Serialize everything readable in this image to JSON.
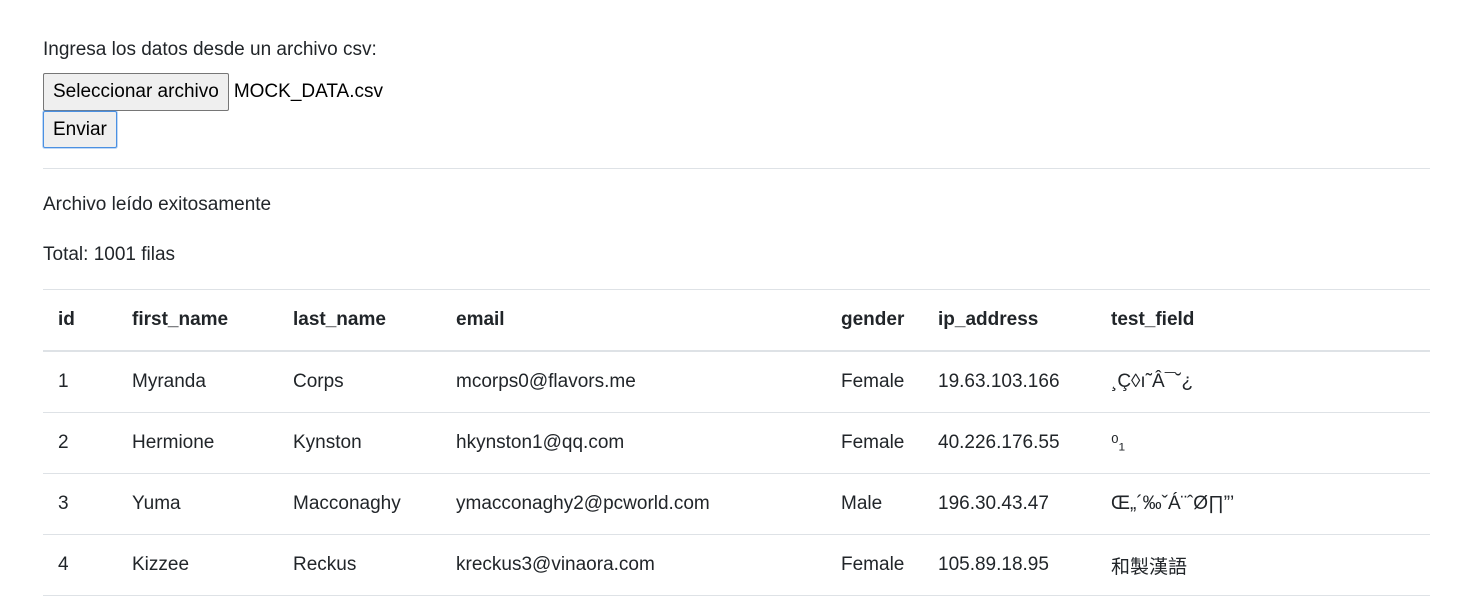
{
  "form": {
    "label": "Ingresa los datos desde un archivo csv:",
    "file_button": "Seleccionar archivo",
    "file_name": "MOCK_DATA.csv",
    "submit": "Enviar"
  },
  "result": {
    "status": "Archivo leído exitosamente",
    "total": "Total: 1001 filas"
  },
  "table": {
    "headers": [
      "id",
      "first_name",
      "last_name",
      "email",
      "gender",
      "ip_address",
      "test_field"
    ],
    "rows": [
      [
        "1",
        "Myranda",
        "Corps",
        "mcorps0@flavors.me",
        "Female",
        "19.63.103.166",
        "¸Ç◊ı˜Â¯˘¿"
      ],
      [
        "2",
        "Hermione",
        "Kynston",
        "hkynston1@qq.com",
        "Female",
        "40.226.176.55",
        "⁰₁"
      ],
      [
        "3",
        "Yuma",
        "Macconaghy",
        "ymacconaghy2@pcworld.com",
        "Male",
        "196.30.43.47",
        "Œ„´‰ˇÁ¨ˆØ∏”’"
      ],
      [
        "4",
        "Kizzee",
        "Reckus",
        "kreckus3@vinaora.com",
        "Female",
        "105.89.18.95",
        "和製漢語"
      ]
    ]
  }
}
